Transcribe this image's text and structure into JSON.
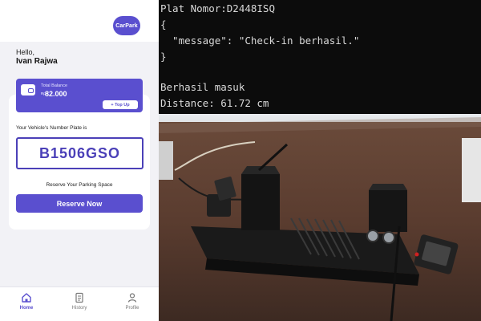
{
  "app": {
    "logo": {
      "part1": "Car",
      "part2": "Park"
    },
    "greeting": "Hello,",
    "user_name": "Ivan Rajwa",
    "balance": {
      "label": "Total Balance",
      "currency": "Rp",
      "amount": "82.000",
      "topup_label": "+ Top Up"
    },
    "plate_caption": "Your Vehicle's Number Plate is",
    "plate_number": "B1506GSO",
    "reserve_caption": "Reserve Your Parking Space",
    "reserve_button": "Reserve Now",
    "nav": [
      {
        "label": "Home",
        "icon": "home-icon",
        "active": true
      },
      {
        "label": "History",
        "icon": "history-icon",
        "active": false
      },
      {
        "label": "Profile",
        "icon": "profile-icon",
        "active": false
      }
    ],
    "colors": {
      "accent": "#5a4fcf",
      "plate_border": "#4b40b8",
      "background": "#f2f2f6"
    }
  },
  "terminal": {
    "lines": [
      "Plat Nomor:D2448ISQ",
      "{",
      "  \"message\": \"Check-in berhasil.\"",
      "}",
      "",
      "Berhasil masuk",
      "Distance: 61.72 cm"
    ]
  },
  "photo": {
    "description_icon": "parking-gate-prototype-image"
  }
}
